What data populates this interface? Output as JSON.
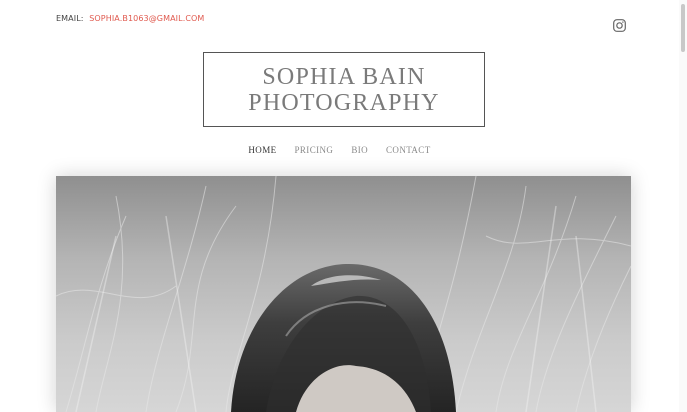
{
  "header": {
    "email_label": "EMAIL:",
    "email_value": "SOPHIA.B1063@GMAIL.COM"
  },
  "logo": {
    "line1": "SOPHIA BAIN",
    "line2": "PHOTOGRAPHY"
  },
  "nav": {
    "items": [
      {
        "label": "HOME",
        "active": true
      },
      {
        "label": "PRICING",
        "active": false
      },
      {
        "label": "BIO",
        "active": false
      },
      {
        "label": "CONTACT",
        "active": false
      }
    ]
  },
  "social": {
    "icon": "instagram-icon"
  },
  "colors": {
    "accent": "#e05a4f",
    "text": "#444444",
    "logo_text": "#7a7a7a",
    "nav_inactive": "#8a8a8a"
  }
}
